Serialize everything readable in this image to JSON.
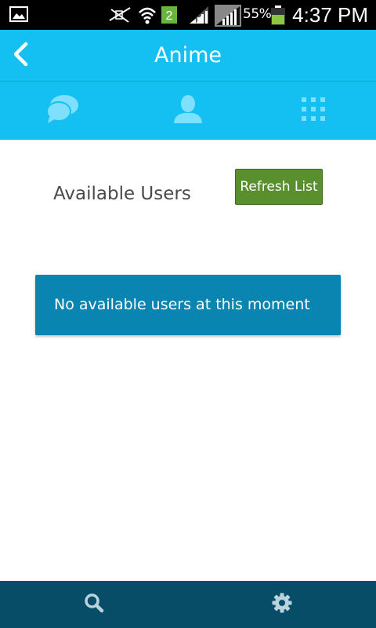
{
  "status_bar": {
    "notification_count": "2",
    "battery_percent": "55%",
    "time": "4:37 PM"
  },
  "app_bar": {
    "title": "Anime"
  },
  "tabs": [
    {
      "icon": "chat-bubbles-icon"
    },
    {
      "icon": "user-icon"
    },
    {
      "icon": "grid-icon"
    }
  ],
  "content": {
    "available_users_label": "Available Users",
    "refresh_button_label": "Refresh List",
    "empty_message": "No available users at this moment"
  },
  "bottom_bar": [
    {
      "icon": "search-icon"
    },
    {
      "icon": "settings-icon"
    }
  ],
  "colors": {
    "primary": "#14c0f2",
    "message_card": "#0a84b0",
    "refresh_button": "#5a8f2e",
    "bottom_bar": "#074d67",
    "icon_light": "#7fe0fd"
  }
}
